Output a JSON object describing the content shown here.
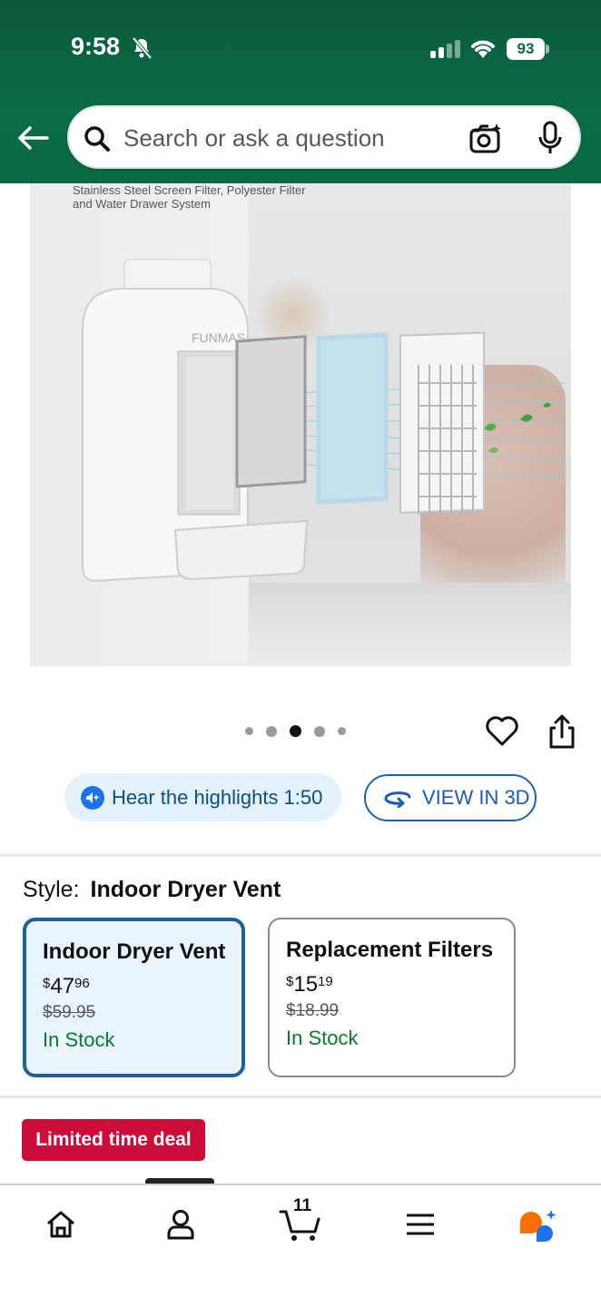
{
  "status_bar": {
    "time": "9:58",
    "battery": "93"
  },
  "search": {
    "placeholder": "Search or ask a question"
  },
  "product_image": {
    "caption_line1": "Stainless Steel Screen Filter, Polyester Filter",
    "caption_line2": "and Water Drawer System",
    "brand_text": "FUNMAS"
  },
  "carousel": {
    "total": 5,
    "active_index": 2
  },
  "actions": {
    "hear_highlights": "Hear the highlights 1:50",
    "view_3d": "VIEW IN 3D"
  },
  "style": {
    "label": "Style:",
    "selected": "Indoor Dryer Vent",
    "options": [
      {
        "title": "Indoor Dryer Vent",
        "currency": "$",
        "price_whole": "47",
        "price_cents": "96",
        "list_price": "$59.95",
        "stock": "In Stock",
        "selected": true
      },
      {
        "title": "Replacement Filters",
        "currency": "$",
        "price_whole": "15",
        "price_cents": "19",
        "list_price": "$18.99",
        "stock": "In Stock",
        "selected": false
      }
    ]
  },
  "deal": {
    "badge": "Limited time deal"
  },
  "bottom_nav": {
    "cart_count": "11",
    "items": [
      "home-icon",
      "account-icon",
      "cart-icon",
      "menu-icon",
      "rufus-icon"
    ]
  },
  "colors": {
    "header_green": "#0b6b45",
    "accent_blue": "#1a63b8",
    "deal_red": "#cc0c39",
    "stock_green": "#0a7a2c"
  }
}
